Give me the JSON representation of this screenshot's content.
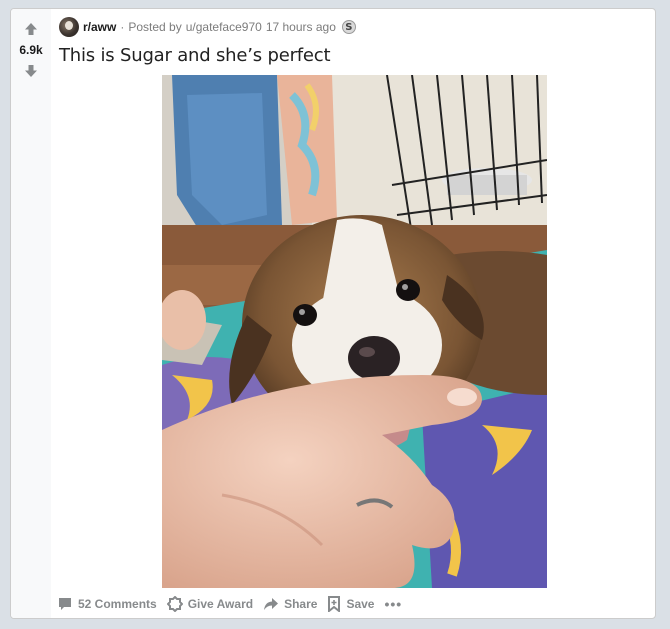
{
  "post": {
    "score": "6.9k",
    "subreddit": "r/aww",
    "posted_prefix": "Posted by",
    "author": "u/gateface970",
    "time": "17 hours ago",
    "award_glyph": "S",
    "title": "This is Sugar and she’s perfect"
  },
  "actions": {
    "comments": "52 Comments",
    "award": "Give Award",
    "share": "Share",
    "save": "Save",
    "more": "•••"
  },
  "colors": {
    "page_bg": "#dae0e6",
    "card_bg": "#ffffff",
    "vote_col_bg": "#f8f9fa",
    "action_gray": "#878a8c"
  },
  "icons": {
    "upvote": "upvote-arrow-icon",
    "downvote": "downvote-arrow-icon",
    "comment": "comment-icon",
    "award": "award-icon",
    "share": "share-icon",
    "save": "bookmark-icon",
    "more": "more-options-icon"
  }
}
